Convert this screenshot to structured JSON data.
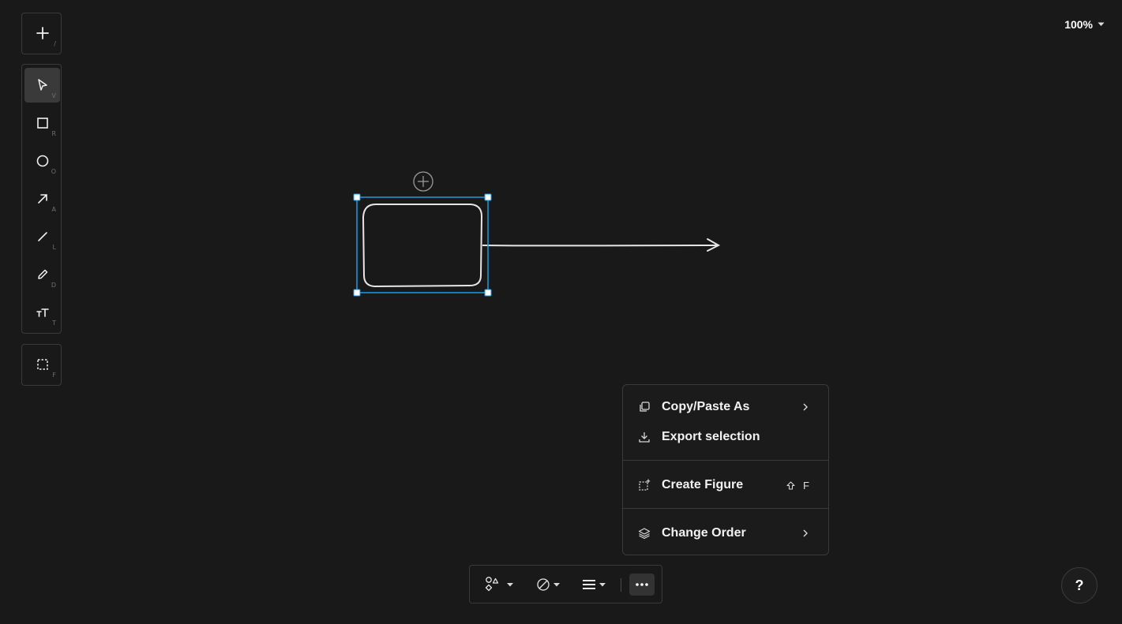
{
  "add_panel": {
    "shortcut": "/"
  },
  "tools": [
    {
      "name": "select",
      "icon": "cursor-icon",
      "shortcut": "V",
      "active": true
    },
    {
      "name": "rectangle",
      "icon": "square-icon",
      "shortcut": "R"
    },
    {
      "name": "ellipse",
      "icon": "circle-icon",
      "shortcut": "O"
    },
    {
      "name": "arrow",
      "icon": "arrow-icon",
      "shortcut": "A"
    },
    {
      "name": "line",
      "icon": "line-icon",
      "shortcut": "L"
    },
    {
      "name": "draw",
      "icon": "pencil-icon",
      "shortcut": "D"
    },
    {
      "name": "text",
      "icon": "text-icon",
      "shortcut": "T"
    }
  ],
  "frame_panel": {
    "icon": "frame-icon",
    "shortcut": "F"
  },
  "zoom": {
    "label": "100%"
  },
  "context_menu": {
    "copy_paste_as": "Copy/Paste As",
    "export_selection": "Export selection",
    "create_figure": "Create Figure",
    "create_figure_shortcut_key": "F",
    "change_order": "Change Order"
  },
  "help": {
    "label": "?"
  },
  "colors": {
    "background": "#191919",
    "selection": "#1f9be3",
    "shape_stroke": "#e6e6e6"
  }
}
